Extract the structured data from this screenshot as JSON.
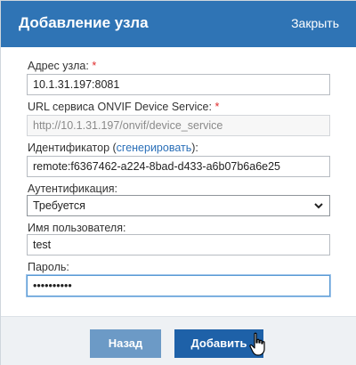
{
  "dialog": {
    "title": "Добавление узла",
    "close_label": "Закрыть"
  },
  "fields": {
    "address": {
      "label": "Адрес узла:",
      "required_mark": "*",
      "value": "10.1.31.197:8081"
    },
    "onvif_url": {
      "label": "URL сервиса ONVIF Device Service:",
      "required_mark": "*",
      "placeholder": "http://10.1.31.197/onvif/device_service"
    },
    "identifier": {
      "label_prefix": "Идентификатор (",
      "generate_link": "сгенерировать",
      "label_suffix": "):",
      "value": "remote:f6367462-a224-8bad-d433-a6b07b6a6e25"
    },
    "auth": {
      "label": "Аутентификация:",
      "selected": "Требуется"
    },
    "username": {
      "label": "Имя пользователя:",
      "value": "test"
    },
    "password": {
      "label": "Пароль:",
      "value": "••••••••••"
    }
  },
  "buttons": {
    "back": "Назад",
    "add": "Добавить"
  },
  "colors": {
    "header": "#2f74b5",
    "button_primary": "#1e61a8",
    "button_secondary": "#6c9ac6",
    "required": "#e02b2b",
    "link": "#2a6fb8"
  }
}
